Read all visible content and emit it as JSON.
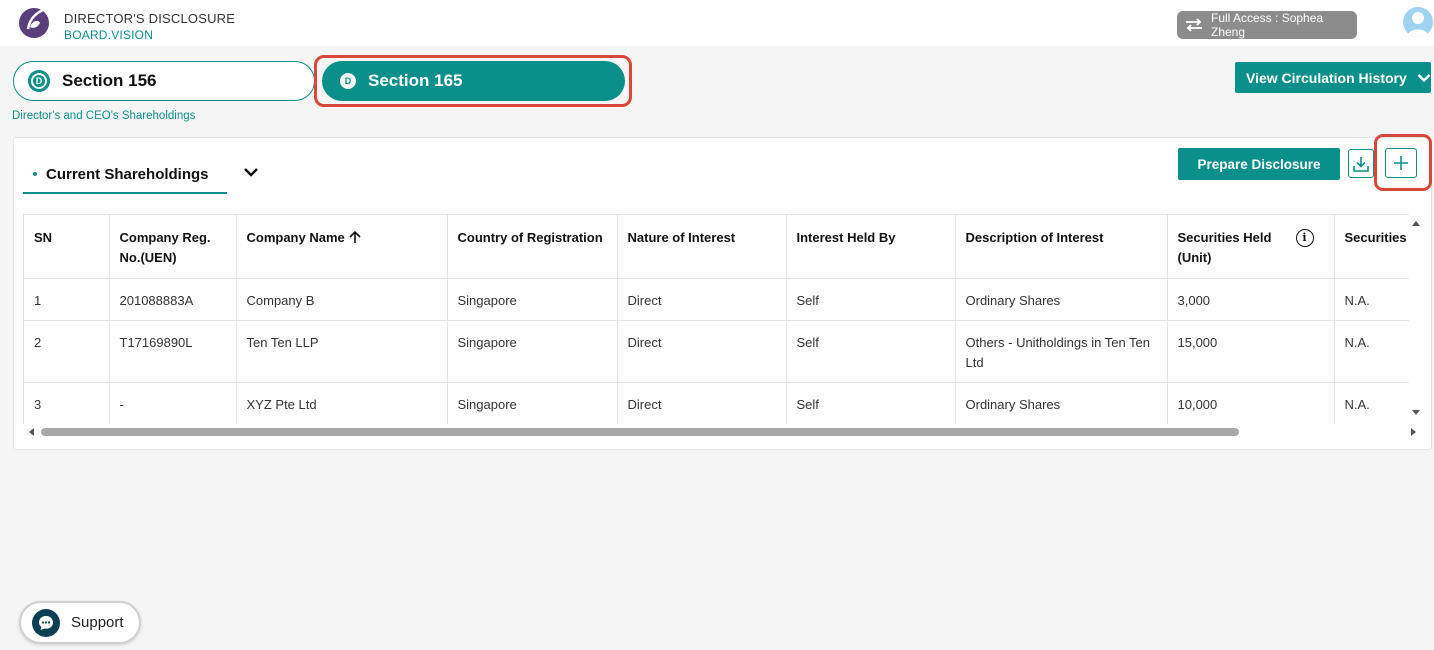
{
  "header": {
    "title": "DIRECTOR'S DISCLOSURE",
    "subtitle": "BOARD.VISION",
    "access_label": "Full Access : Sophea Zheng"
  },
  "sections": {
    "tab1": {
      "badge": "D",
      "label": "Section 156"
    },
    "tab2": {
      "badge": "D",
      "label": "Section 165"
    },
    "caption": "Director's and CEO's Shareholdings",
    "view_history_label": "View Circulation History"
  },
  "card": {
    "subtab_label": "Current Shareholdings",
    "prepare_label": "Prepare Disclosure"
  },
  "table": {
    "headers": {
      "sn": "SN",
      "reg": "Company Reg. No.(UEN)",
      "name": "Company Name",
      "country": "Country of Registration",
      "nature": "Nature of Interest",
      "held_by": "Interest Held By",
      "desc": "Description of Interest",
      "securities": "Securities Held (Unit)",
      "securities2": "Securities"
    },
    "rows": [
      {
        "sn": "1",
        "reg": "201088883A",
        "name": "Company B",
        "country": "Singapore",
        "nature": "Direct",
        "held_by": "Self",
        "desc": "Ordinary Shares",
        "securities": "3,000",
        "securities2": "N.A."
      },
      {
        "sn": "2",
        "reg": "T17169890L",
        "name": "Ten Ten LLP",
        "country": "Singapore",
        "nature": "Direct",
        "held_by": "Self",
        "desc": "Others - Unitholdings in Ten Ten Ltd",
        "securities": "15,000",
        "securities2": "N.A."
      },
      {
        "sn": "3",
        "reg": "-",
        "name": "XYZ Pte Ltd",
        "country": "Singapore",
        "nature": "Direct",
        "held_by": "Self",
        "desc": "Ordinary Shares",
        "securities": "10,000",
        "securities2": "N.A."
      }
    ]
  },
  "support_label": "Support",
  "colors": {
    "primary": "#0a8f8a",
    "highlight": "#d9473b",
    "support": "#0c3f52"
  }
}
